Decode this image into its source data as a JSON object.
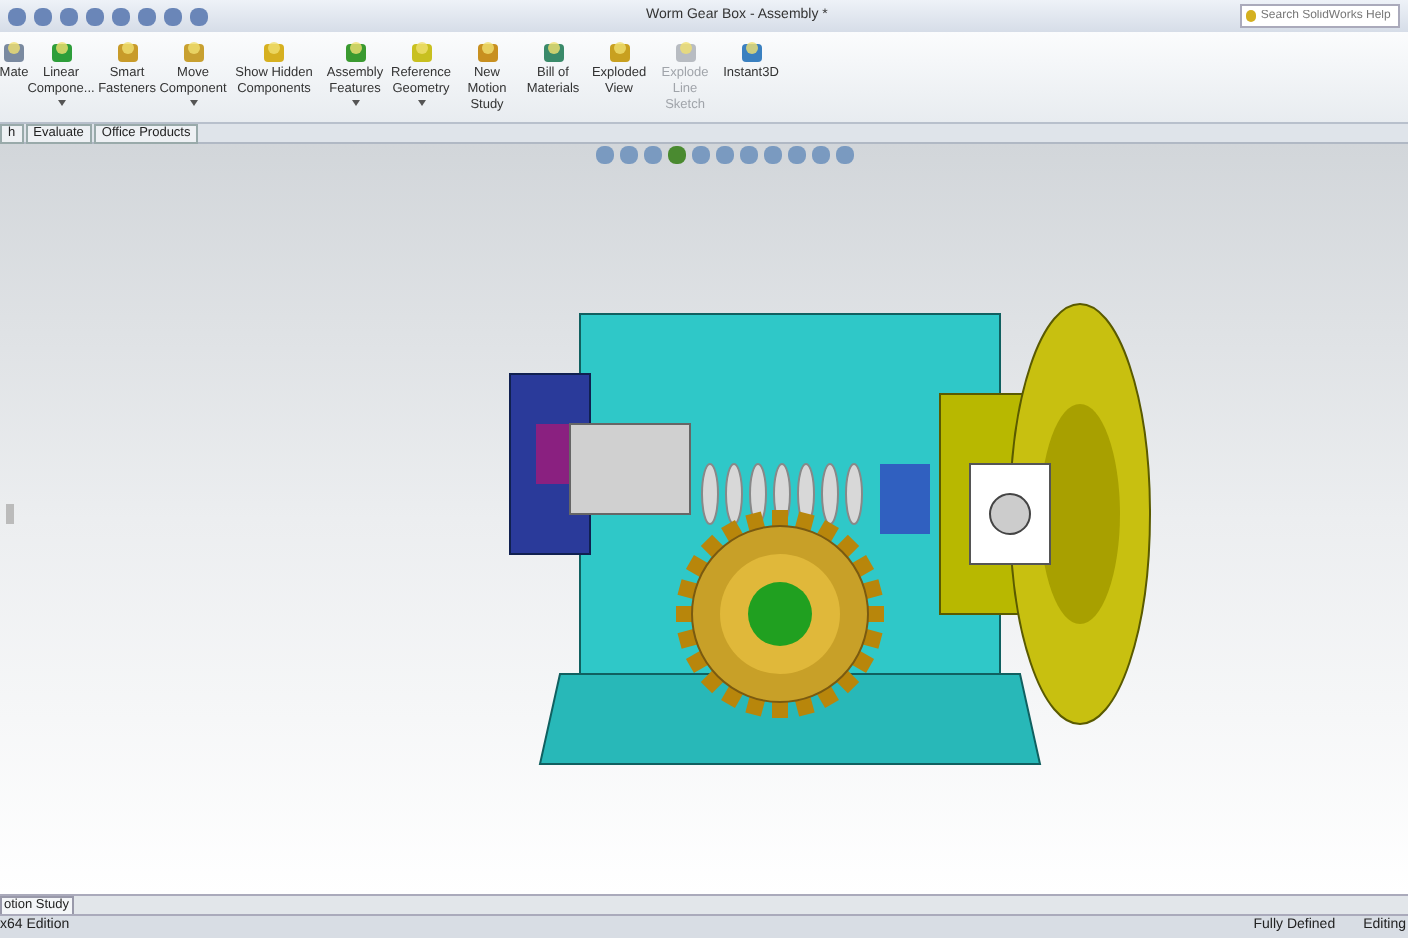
{
  "window": {
    "title": "Worm Gear Box - Assembly *"
  },
  "search": {
    "placeholder": "Search SolidWorks Help"
  },
  "commands": [
    {
      "label": "Mate",
      "has_menu": false,
      "disabled": false
    },
    {
      "label": "Linear Compone...",
      "has_menu": true,
      "disabled": false
    },
    {
      "label": "Smart Fasteners",
      "has_menu": false,
      "disabled": false
    },
    {
      "label": "Move Component",
      "has_menu": true,
      "disabled": false
    },
    {
      "label": "Show Hidden Components",
      "has_menu": false,
      "disabled": false
    },
    {
      "label": "Assembly Features",
      "has_menu": true,
      "disabled": false
    },
    {
      "label": "Reference Geometry",
      "has_menu": true,
      "disabled": false
    },
    {
      "label": "New Motion Study",
      "has_menu": false,
      "disabled": false
    },
    {
      "label": "Bill of Materials",
      "has_menu": false,
      "disabled": false
    },
    {
      "label": "Exploded View",
      "has_menu": false,
      "disabled": false
    },
    {
      "label": "Explode Line Sketch",
      "has_menu": false,
      "disabled": true
    },
    {
      "label": "Instant3D",
      "has_menu": false,
      "disabled": false
    }
  ],
  "tabs": [
    {
      "label": "h"
    },
    {
      "label": "Evaluate"
    },
    {
      "label": "Office Products"
    }
  ],
  "bottom_tab": {
    "label": "otion Study"
  },
  "status_bar": {
    "left": "x64 Edition",
    "right": [
      "Fully Defined",
      "Editing"
    ]
  }
}
